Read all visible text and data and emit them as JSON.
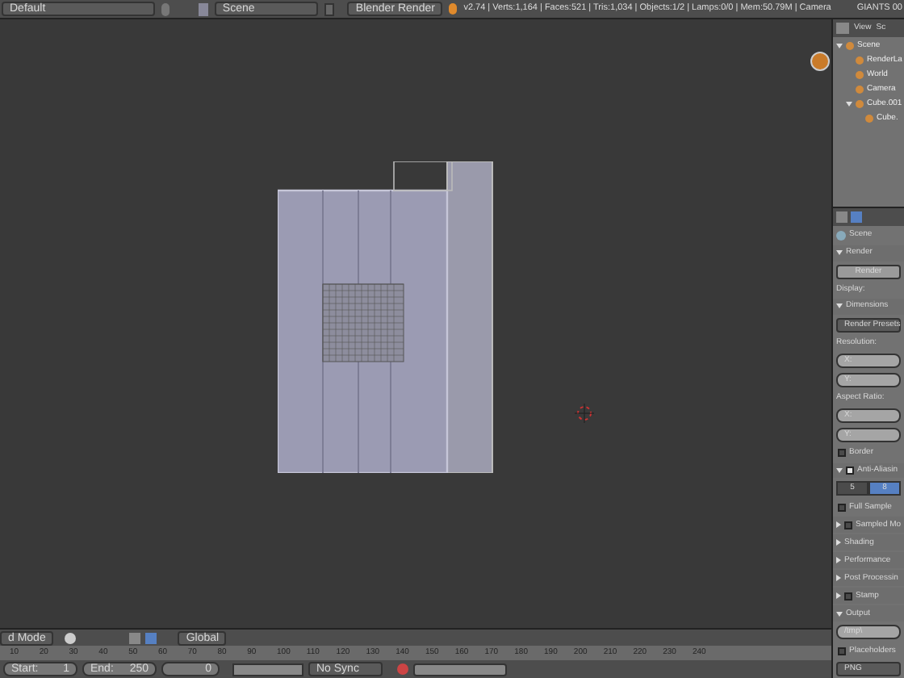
{
  "top_bar": {
    "layout": "Default",
    "scene": "Scene",
    "engine": "Blender Render",
    "stats": "v2.74 | Verts:1,164 | Faces:521 | Tris:1,034 | Objects:1/2 | Lamps:0/0 | Mem:50.79M | Camera",
    "brand": "GIANTS 00"
  },
  "viewport_header": {
    "mode": "d Mode",
    "orientation": "Global"
  },
  "timeline": {
    "ticks": [
      "10",
      "20",
      "30",
      "40",
      "50",
      "60",
      "70",
      "80",
      "90",
      "100",
      "110",
      "120",
      "130",
      "140",
      "150",
      "160",
      "170",
      "180",
      "190",
      "200",
      "210",
      "220",
      "230",
      "240"
    ],
    "start_label": "Start:",
    "start": "1",
    "end_label": "End:",
    "end": "250",
    "frame": "0",
    "sync": "No Sync"
  },
  "outliner": {
    "menu": [
      "View",
      "Sc"
    ],
    "tree": [
      {
        "label": "Scene",
        "expanded": true,
        "children": [
          {
            "label": "RenderLa"
          },
          {
            "label": "World"
          },
          {
            "label": "Camera"
          },
          {
            "label": "Cube.001",
            "expanded": true,
            "children": [
              {
                "label": "Cube."
              }
            ]
          }
        ]
      }
    ]
  },
  "properties": {
    "scene": "Scene",
    "rows": [
      {
        "kind": "panel",
        "label": "Render",
        "expanded": true
      },
      {
        "kind": "button",
        "label": "Render"
      },
      {
        "kind": "label",
        "label": "Display:"
      },
      {
        "kind": "panel",
        "label": "Dimensions",
        "expanded": true
      },
      {
        "kind": "menu",
        "label": "Render Presets"
      },
      {
        "kind": "label",
        "label": "Resolution:"
      },
      {
        "kind": "field",
        "label": "X:"
      },
      {
        "kind": "field",
        "label": "Y:"
      },
      {
        "kind": "label",
        "label": "Aspect Ratio:"
      },
      {
        "kind": "field",
        "label": "X:"
      },
      {
        "kind": "field",
        "label": "Y:"
      },
      {
        "kind": "check",
        "label": "Border",
        "checked": false
      },
      {
        "kind": "panel",
        "label": "Anti-Aliasin",
        "expanded": true,
        "checked": true
      },
      {
        "kind": "segments",
        "options": [
          {
            "label": "5",
            "selected": false
          },
          {
            "label": "8",
            "selected": true
          }
        ]
      },
      {
        "kind": "check",
        "label": "Full Sample",
        "checked": false
      },
      {
        "kind": "panel",
        "label": "Sampled Mo",
        "expanded": false,
        "checked": false
      },
      {
        "kind": "panel",
        "label": "Shading",
        "expanded": false
      },
      {
        "kind": "panel",
        "label": "Performance",
        "expanded": false
      },
      {
        "kind": "panel",
        "label": "Post Processin",
        "expanded": false
      },
      {
        "kind": "panel",
        "label": "Stamp",
        "expanded": false,
        "checked": false
      },
      {
        "kind": "panel",
        "label": "Output",
        "expanded": true
      },
      {
        "kind": "field",
        "label": "/tmp\\"
      },
      {
        "kind": "check",
        "label": "Placeholders",
        "checked": false
      },
      {
        "kind": "menu",
        "label": "PNG"
      }
    ]
  }
}
